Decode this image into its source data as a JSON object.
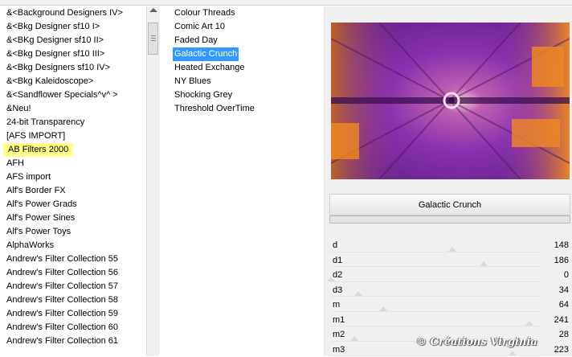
{
  "categories": [
    "&<Background Designers IV>",
    "&<Bkg Designer sf10 I>",
    "&<BKg Designer sf10 II>",
    "&<Bkg Designer sf10 III>",
    "&<Bkg Designers sf10 IV>",
    "&<Bkg Kaleidoscope>",
    "&<Sandflower Specials^v^ >",
    "&Neu!",
    "24-bit Transparency",
    "[AFS IMPORT]",
    "AB Filters 2000",
    "AFH",
    "AFS import",
    "Alf's Border FX",
    "Alf's Power Grads",
    "Alf's Power Sines",
    "Alf's Power Toys",
    "AlphaWorks",
    "Andrew's Filter Collection 55",
    "Andrew's Filter Collection 56",
    "Andrew's Filter Collection 57",
    "Andrew's Filter Collection 58",
    "Andrew's Filter Collection 59",
    "Andrew's Filter Collection 60",
    "Andrew's Filter Collection 61"
  ],
  "highlighted_category": "AB Filters 2000",
  "filters": [
    "Colour Threads",
    "Comic Art 10",
    "Faded Day",
    "Galactic Crunch",
    "Heated Exchange",
    "NY Blues",
    "Shocking Grey",
    "Threshold OverTime"
  ],
  "selected_filter": "Galactic Crunch",
  "filter_title": "Galactic Crunch",
  "params": [
    {
      "name": "d",
      "value": "148",
      "level": 0.58
    },
    {
      "name": "d1",
      "value": "186",
      "level": 0.73
    },
    {
      "name": "d2",
      "value": "0",
      "level": 0.0
    },
    {
      "name": "d3",
      "value": "34",
      "level": 0.13
    },
    {
      "name": "m",
      "value": "64",
      "level": 0.25
    },
    {
      "name": "m1",
      "value": "241",
      "level": 0.95
    },
    {
      "name": "m2",
      "value": "28",
      "level": 0.11
    },
    {
      "name": "m3",
      "value": "223",
      "level": 0.87
    }
  ],
  "watermark": "© Créations Virginia",
  "colors": {
    "selection": "#3399ff",
    "highlight": "#ffff8a",
    "panel": "#f0f0f0"
  }
}
